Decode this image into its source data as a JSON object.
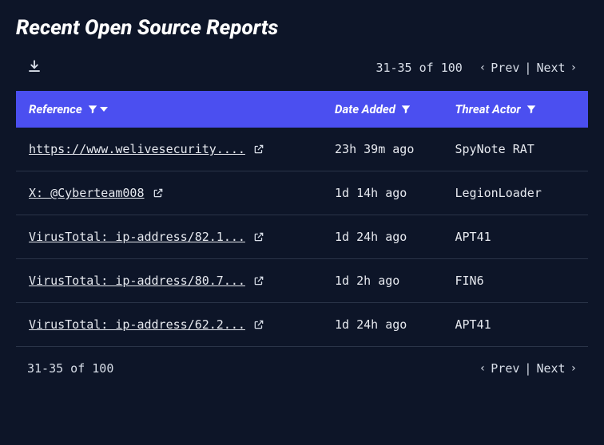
{
  "title": "Recent Open Source Reports",
  "pagination": {
    "range_label": "31-35 of 100",
    "prev_label": "Prev",
    "next_label": "Next"
  },
  "columns": {
    "reference": "Reference",
    "date_added": "Date Added",
    "threat_actor": "Threat Actor"
  },
  "rows": [
    {
      "reference": "https://www.welivesecurity....",
      "date_added": "23h 39m ago",
      "threat_actor": "SpyNote RAT"
    },
    {
      "reference": "X: @Cyberteam008",
      "date_added": "1d 14h ago",
      "threat_actor": "LegionLoader"
    },
    {
      "reference": "VirusTotal: ip-address/82.1...",
      "date_added": "1d 24h ago",
      "threat_actor": "APT41"
    },
    {
      "reference": "VirusTotal: ip-address/80.7...",
      "date_added": "1d 2h ago",
      "threat_actor": "FIN6"
    },
    {
      "reference": "VirusTotal: ip-address/62.2...",
      "date_added": "1d 24h ago",
      "threat_actor": "APT41"
    }
  ]
}
